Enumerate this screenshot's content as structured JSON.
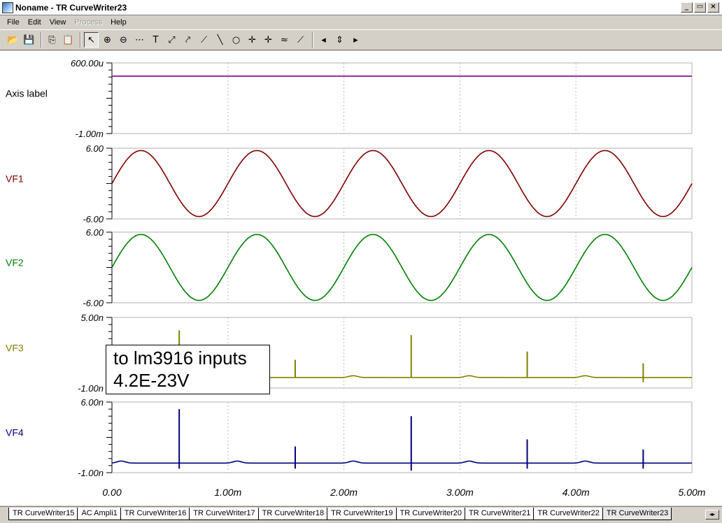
{
  "window": {
    "title": "Noname - TR CurveWriter23",
    "buttons": {
      "minimize": "_",
      "maximize": "▭",
      "close": "×"
    }
  },
  "menu": [
    {
      "label": "File",
      "enabled": true
    },
    {
      "label": "Edit",
      "enabled": true
    },
    {
      "label": "View",
      "enabled": true
    },
    {
      "label": "Process",
      "enabled": false
    },
    {
      "label": "Help",
      "enabled": true
    }
  ],
  "toolbar": [
    {
      "name": "open-icon",
      "glyph": "📂"
    },
    {
      "name": "save-icon",
      "glyph": "💾"
    },
    {
      "name": "sep"
    },
    {
      "name": "copy-icon",
      "glyph": "⎘"
    },
    {
      "name": "paste-icon",
      "glyph": "📋"
    },
    {
      "name": "sep"
    },
    {
      "name": "pointer-icon",
      "glyph": "↖",
      "pressed": true
    },
    {
      "name": "zoom-in-icon",
      "glyph": "⊕"
    },
    {
      "name": "zoom-out-icon",
      "glyph": "⊖"
    },
    {
      "name": "grid-icon",
      "glyph": "⋯"
    },
    {
      "name": "text-icon",
      "glyph": "T"
    },
    {
      "name": "cursor-tool-icon",
      "glyph": "⤢"
    },
    {
      "name": "marker-tool-icon",
      "glyph": "⤤"
    },
    {
      "name": "slope-icon",
      "glyph": "⟋"
    },
    {
      "name": "line-icon",
      "glyph": "╲"
    },
    {
      "name": "circle-icon",
      "glyph": "○"
    },
    {
      "name": "cursor-a-icon",
      "glyph": "✛"
    },
    {
      "name": "cursor-b-icon",
      "glyph": "✛"
    },
    {
      "name": "add-curve-icon",
      "glyph": "≈"
    },
    {
      "name": "probe-icon",
      "glyph": "⟋"
    },
    {
      "name": "sep"
    },
    {
      "name": "arrow-left-icon",
      "glyph": "◂"
    },
    {
      "name": "arrow-up-down-icon",
      "glyph": "⇕"
    },
    {
      "name": "arrow-right-icon",
      "glyph": "▸"
    }
  ],
  "annotation": {
    "line1": "to lm3916 inputs",
    "line2": "4.2E-23V"
  },
  "chart_data": {
    "type": "line",
    "x_axis": {
      "ticks": [
        "0.00",
        "1.00m",
        "2.00m",
        "3.00m",
        "4.00m",
        "5.00m"
      ],
      "range": [
        0,
        0.005
      ]
    },
    "grid": true,
    "panels": [
      {
        "label": "Axis label",
        "label_color": "#000000",
        "color": "#800080",
        "y_top_label": "600.00u",
        "y_bottom_label": "-1.00m",
        "ylim": [
          -0.001,
          0.0006
        ],
        "kind": "flat",
        "value": 0.0003
      },
      {
        "label": "VF1",
        "label_color": "#800000",
        "color": "#800000",
        "y_top_label": "6.00",
        "y_bottom_label": "-6.00",
        "ylim": [
          -6,
          6
        ],
        "kind": "sine",
        "amplitude": 5.6,
        "frequency_hz": 1000,
        "clip": -5.6
      },
      {
        "label": "VF2",
        "label_color": "#008000",
        "color": "#008000",
        "y_top_label": "6.00",
        "y_bottom_label": "-6.00",
        "ylim": [
          -6,
          6
        ],
        "kind": "sine",
        "amplitude": 5.6,
        "frequency_hz": 1000,
        "clip": -5.6
      },
      {
        "label": "VF3",
        "label_color": "#808000",
        "color": "#808000",
        "y_top_label": "5.00n",
        "y_bottom_label": "-1.00n",
        "ylim": [
          -1e-09,
          5e-09
        ],
        "kind": "spikes",
        "baseline": -1e-10,
        "bump": 1.5e-10,
        "spikes": [
          {
            "t": 0.00058,
            "v": 3.9e-09,
            "low": -1e-10
          },
          {
            "t": 0.00158,
            "v": 1.4e-09,
            "low": -1e-10
          },
          {
            "t": 0.00258,
            "v": 3.5e-09,
            "low": -1e-10
          },
          {
            "t": 0.00358,
            "v": 2.1e-09,
            "low": -1e-10
          },
          {
            "t": 0.00458,
            "v": 1.1e-09,
            "low": -5e-10
          }
        ]
      },
      {
        "label": "VF4",
        "label_color": "#000080",
        "color": "#000080",
        "y_top_label": "6.00n",
        "y_bottom_label": "-1.00n",
        "ylim": [
          -1e-09,
          6e-09
        ],
        "kind": "spikes",
        "baseline": -5e-11,
        "bump": 2e-10,
        "spikes": [
          {
            "t": 0.00058,
            "v": 5.3e-09,
            "low": -6e-10
          },
          {
            "t": 0.00158,
            "v": 1.6e-09,
            "low": -6e-10
          },
          {
            "t": 0.00258,
            "v": 4.6e-09,
            "low": -8e-10
          },
          {
            "t": 0.00358,
            "v": 2.3e-09,
            "low": -6e-10
          },
          {
            "t": 0.00458,
            "v": 1.3e-09,
            "low": -6e-10
          }
        ]
      }
    ]
  },
  "tabs": [
    {
      "label": "TR CurveWriter15",
      "active": false
    },
    {
      "label": "AC Ampli1",
      "active": false
    },
    {
      "label": "TR CurveWriter16",
      "active": false
    },
    {
      "label": "TR CurveWriter17",
      "active": false
    },
    {
      "label": "TR CurveWriter18",
      "active": false
    },
    {
      "label": "TR CurveWriter19",
      "active": false
    },
    {
      "label": "TR CurveWriter20",
      "active": false
    },
    {
      "label": "TR CurveWriter21",
      "active": false
    },
    {
      "label": "TR CurveWriter22",
      "active": false
    },
    {
      "label": "TR CurveWriter23",
      "active": true
    }
  ],
  "tab_scroll_glyph": "◂▸"
}
